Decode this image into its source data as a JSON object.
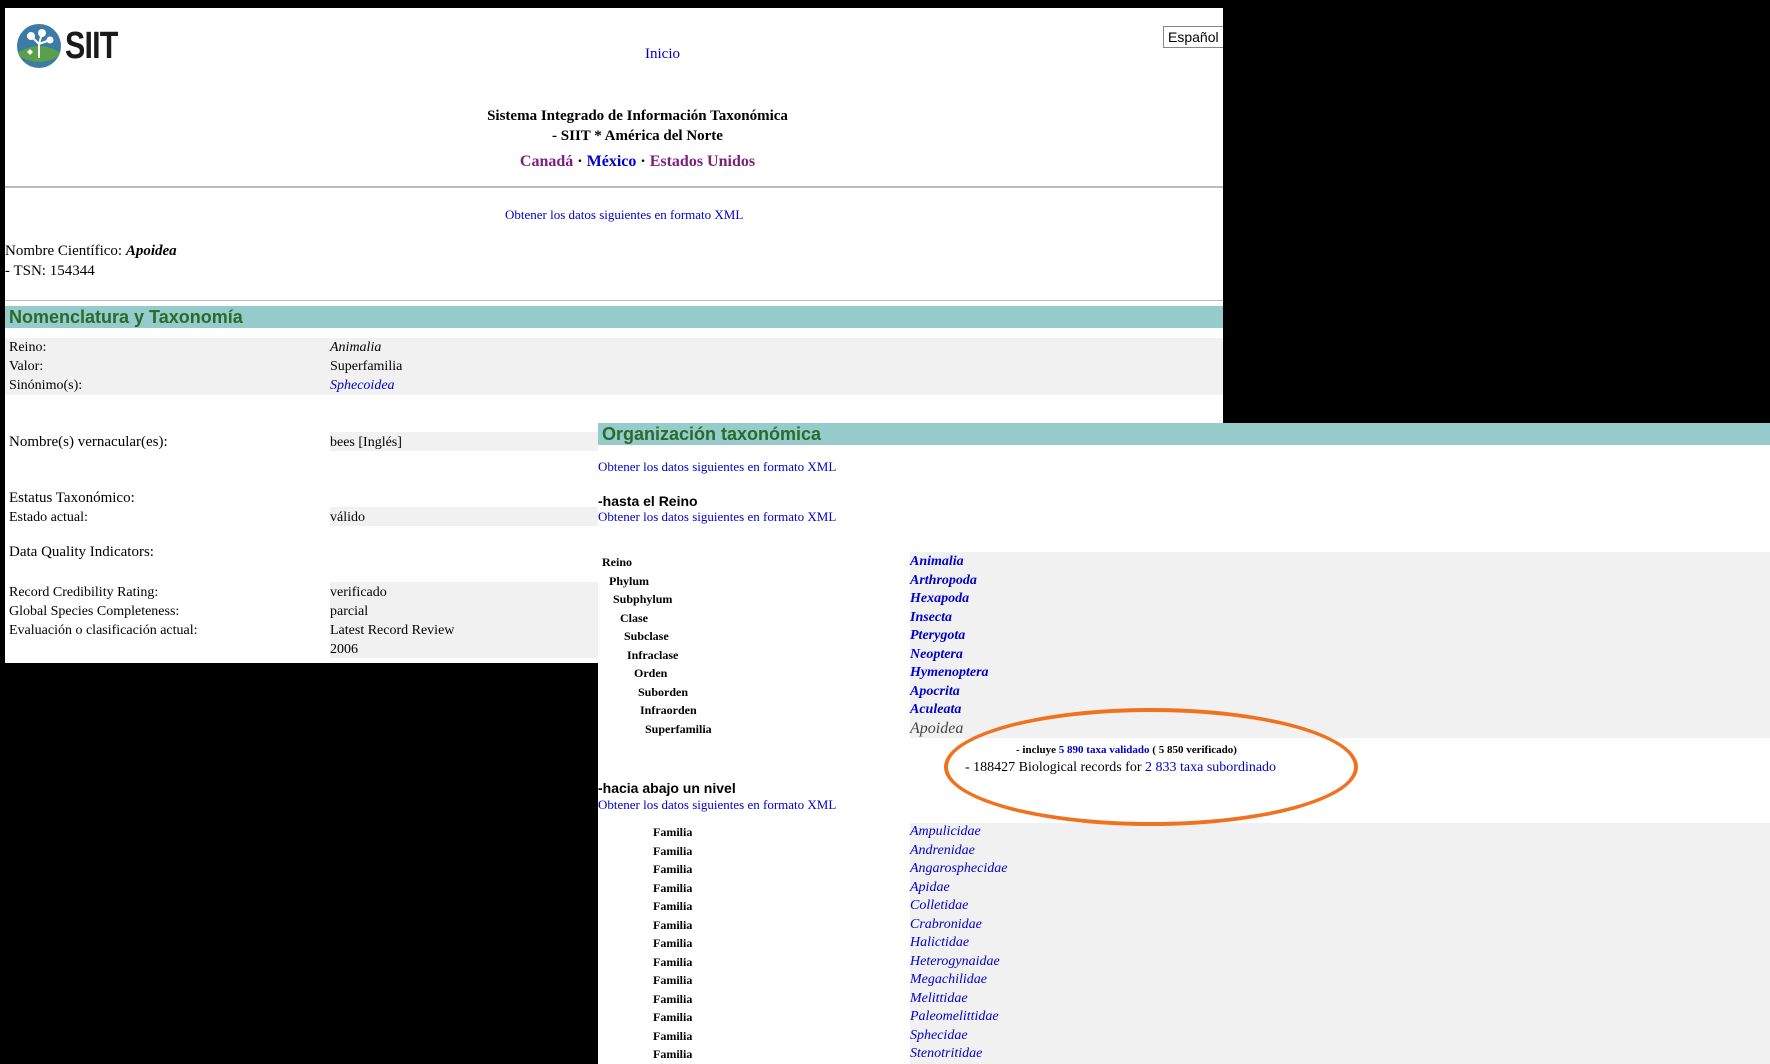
{
  "header": {
    "logo_text": "SIIT",
    "home_link": "Inicio",
    "language": "Español",
    "title_line1": "Sistema Integrado de Información Taxonómica",
    "title_line2": "- SIIT * América del Norte",
    "countries": [
      "Canadá",
      "México",
      "Estados Unidos"
    ],
    "separator": "·"
  },
  "xml_link": "Obtener los datos siguientes en formato XML",
  "record": {
    "sci_label": "Nombre Científico:",
    "sci_name": "Apoidea",
    "tsn": "- TSN: 154344"
  },
  "nomenclature": {
    "title": "Nomenclatura y Taxonomía",
    "rows": [
      {
        "label": "Reino:",
        "value": "Animalia",
        "italic": true
      },
      {
        "label": "Valor:",
        "value": "Superfamilia"
      },
      {
        "label": "Sinónimo(s):",
        "value": "Sphecoidea",
        "link": true
      }
    ],
    "vernacular_label": "Nombre(s) vernacular(es):",
    "vernacular_value": "bees [Inglés]",
    "status_label": "Estatus Taxonómico:",
    "current_label": "Estado actual:",
    "current_value": "válido",
    "dq_label": "Data Quality Indicators:",
    "dq_rows": [
      {
        "label": "Record Credibility Rating:",
        "value": "verificado"
      },
      {
        "label": "Global Species Completeness:",
        "value": "parcial"
      },
      {
        "label": "Evaluación o clasificación actual:",
        "value": "Latest Record Review"
      }
    ],
    "review_year": "2006"
  },
  "organization": {
    "title": "Organización taxonómica",
    "up_label": "-hasta el Reino",
    "hierarchy": [
      {
        "rank": "Reino",
        "name": "Animalia"
      },
      {
        "rank": "Phylum",
        "name": "Arthropoda"
      },
      {
        "rank": "Subphylum",
        "name": "Hexapoda"
      },
      {
        "rank": "Clase",
        "name": "Insecta"
      },
      {
        "rank": "Subclase",
        "name": "Pterygota"
      },
      {
        "rank": "Infraclase",
        "name": "Neoptera"
      },
      {
        "rank": "Orden",
        "name": "Hymenoptera"
      },
      {
        "rank": "Suborden",
        "name": "Apocrita"
      },
      {
        "rank": "Infraorden",
        "name": "Aculeata"
      },
      {
        "rank": "Superfamilia",
        "name": "Apoidea"
      }
    ],
    "includes_prefix": "- incluye",
    "includes_link": "5 890 taxa validado",
    "includes_suffix": "( 5 850 verificado)",
    "records_prefix": "- 188427 Biological records for",
    "records_link": "2 833 taxa subordinado",
    "down_label": "-hacia abajo un nivel",
    "families": [
      {
        "rank": "Familia",
        "name": "Ampulicidae"
      },
      {
        "rank": "Familia",
        "name": "Andrenidae"
      },
      {
        "rank": "Familia",
        "name": "Angarosphecidae"
      },
      {
        "rank": "Familia",
        "name": "Apidae"
      },
      {
        "rank": "Familia",
        "name": "Colletidae"
      },
      {
        "rank": "Familia",
        "name": "Crabronidae"
      },
      {
        "rank": "Familia",
        "name": "Halictidae"
      },
      {
        "rank": "Familia",
        "name": "Heterogynaidae"
      },
      {
        "rank": "Familia",
        "name": "Megachilidae"
      },
      {
        "rank": "Familia",
        "name": "Melittidae"
      },
      {
        "rank": "Familia",
        "name": "Paleomelittidae"
      },
      {
        "rank": "Familia",
        "name": "Sphecidae"
      },
      {
        "rank": "Familia",
        "name": "Stenotritidae"
      }
    ]
  },
  "colors": {
    "section_bar": "#96cbcb",
    "section_text": "#2a6a2a",
    "annotation": "#f0721e",
    "link": "#0000cc",
    "visited": "#7a1f7a"
  }
}
